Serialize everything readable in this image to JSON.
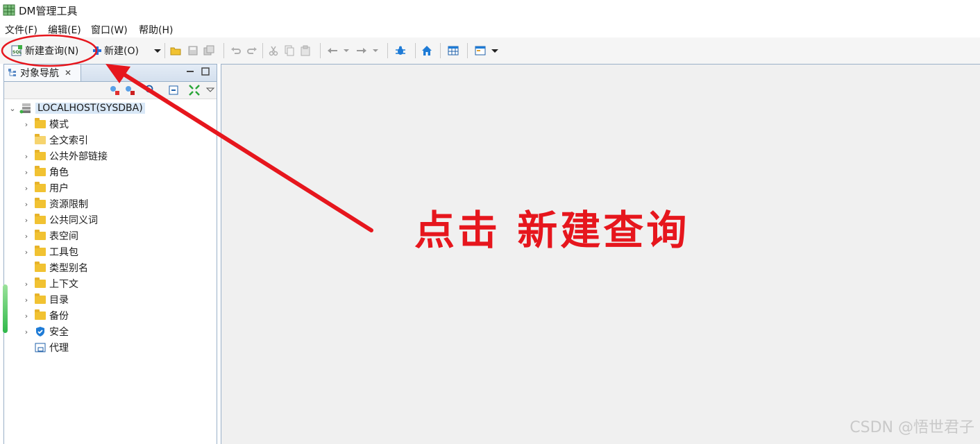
{
  "app": {
    "title": "DM管理工具",
    "icon": "database-grid-icon"
  },
  "menubar": {
    "items": [
      "文件(F)",
      "编辑(E)",
      "窗口(W)",
      "帮助(H)"
    ]
  },
  "toolbar": {
    "new_query_label": "新建查询(N)",
    "new_label": "新建(O)",
    "icons": [
      "sql-new-query-icon",
      "plus-icon",
      "dropdown-arrow-icon",
      "open-folder-icon",
      "save-icon",
      "save-all-icon",
      "undo-icon",
      "redo-icon",
      "cut-icon",
      "copy-icon",
      "paste-icon",
      "back-arrow-icon",
      "forward-arrow-icon",
      "bug-icon",
      "home-icon",
      "table-icon",
      "window-layout-icon"
    ]
  },
  "nav": {
    "tab_title": "对象导航",
    "root": "LOCALHOST(SYSDBA)",
    "items": [
      {
        "label": "模式",
        "expandable": true,
        "icon": "folder-icon"
      },
      {
        "label": "全文索引",
        "expandable": false,
        "icon": "folder-open-icon"
      },
      {
        "label": "公共外部链接",
        "expandable": true,
        "icon": "folder-icon"
      },
      {
        "label": "角色",
        "expandable": true,
        "icon": "folder-icon"
      },
      {
        "label": "用户",
        "expandable": true,
        "icon": "folder-icon"
      },
      {
        "label": "资源限制",
        "expandable": true,
        "icon": "folder-icon"
      },
      {
        "label": "公共同义词",
        "expandable": true,
        "icon": "folder-icon"
      },
      {
        "label": "表空间",
        "expandable": true,
        "icon": "folder-icon"
      },
      {
        "label": "工具包",
        "expandable": true,
        "icon": "folder-icon"
      },
      {
        "label": "类型别名",
        "expandable": false,
        "icon": "folder-icon"
      },
      {
        "label": "上下文",
        "expandable": true,
        "icon": "folder-icon"
      },
      {
        "label": "目录",
        "expandable": true,
        "icon": "folder-icon"
      },
      {
        "label": "备份",
        "expandable": true,
        "icon": "folder-icon"
      },
      {
        "label": "安全",
        "expandable": true,
        "icon": "shield-icon"
      },
      {
        "label": "代理",
        "expandable": false,
        "icon": "proxy-icon"
      }
    ]
  },
  "annotation": {
    "text": "点击 新建查询",
    "color": "#e6161d"
  },
  "watermark": "CSDN @悟世君子"
}
